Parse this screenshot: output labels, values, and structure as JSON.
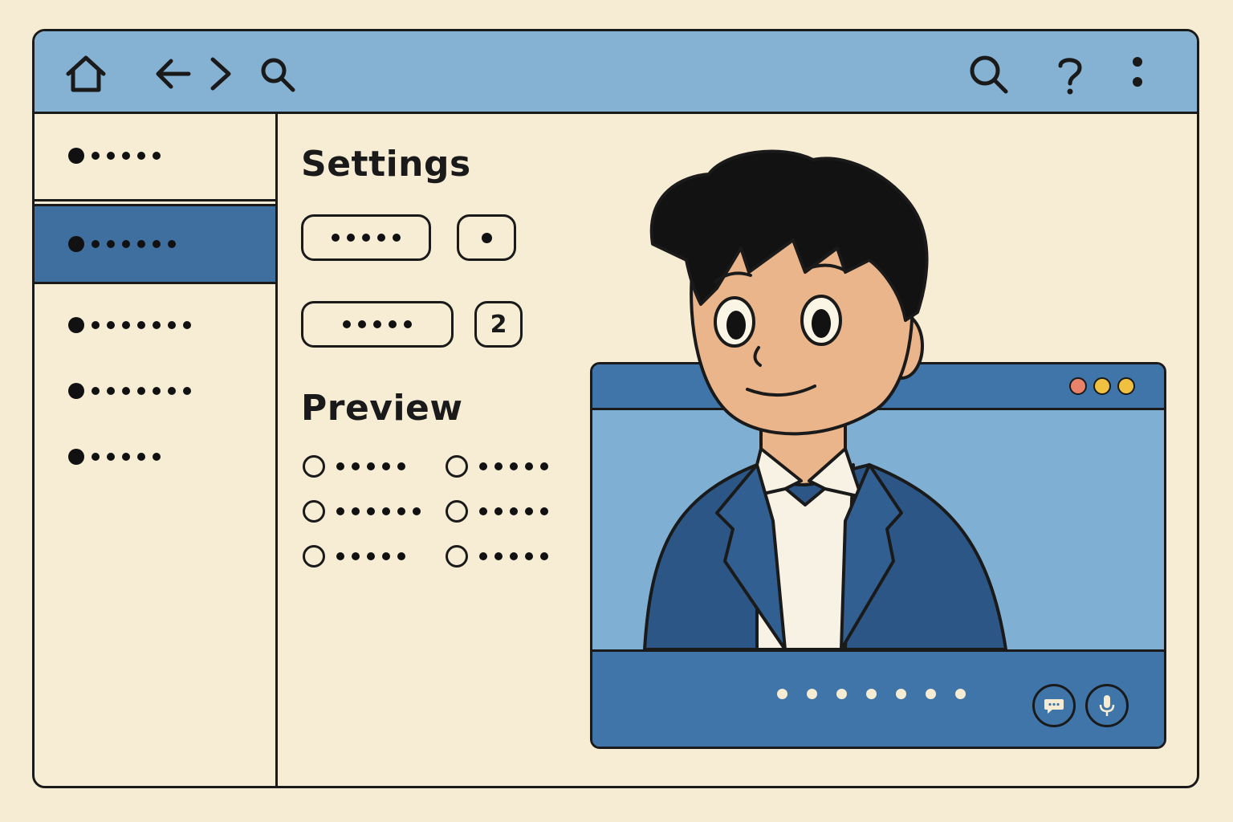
{
  "toolbar": {
    "icons": [
      "home-icon",
      "back-arrow-icon",
      "forward-arrow-icon",
      "search-icon",
      "search-icon",
      "help-icon",
      "more-vertical-icon"
    ]
  },
  "sidebar": {
    "items": [
      {
        "state": "normal"
      },
      {
        "state": "selected"
      },
      {
        "state": "normal"
      },
      {
        "state": "normal"
      },
      {
        "state": "normal"
      }
    ]
  },
  "settings": {
    "title": "Settings",
    "badge_value": "2"
  },
  "preview": {
    "title": "Preview"
  },
  "video_call": {
    "window_dots": [
      "#e8826b",
      "#f0c040",
      "#f0c040"
    ],
    "controls": [
      "chat-icon",
      "microphone-icon"
    ]
  },
  "colors": {
    "background": "#f6ecd3",
    "titlebar": "#85b2d3",
    "accent": "#3e6f9f",
    "outline": "#1a1a1a"
  }
}
